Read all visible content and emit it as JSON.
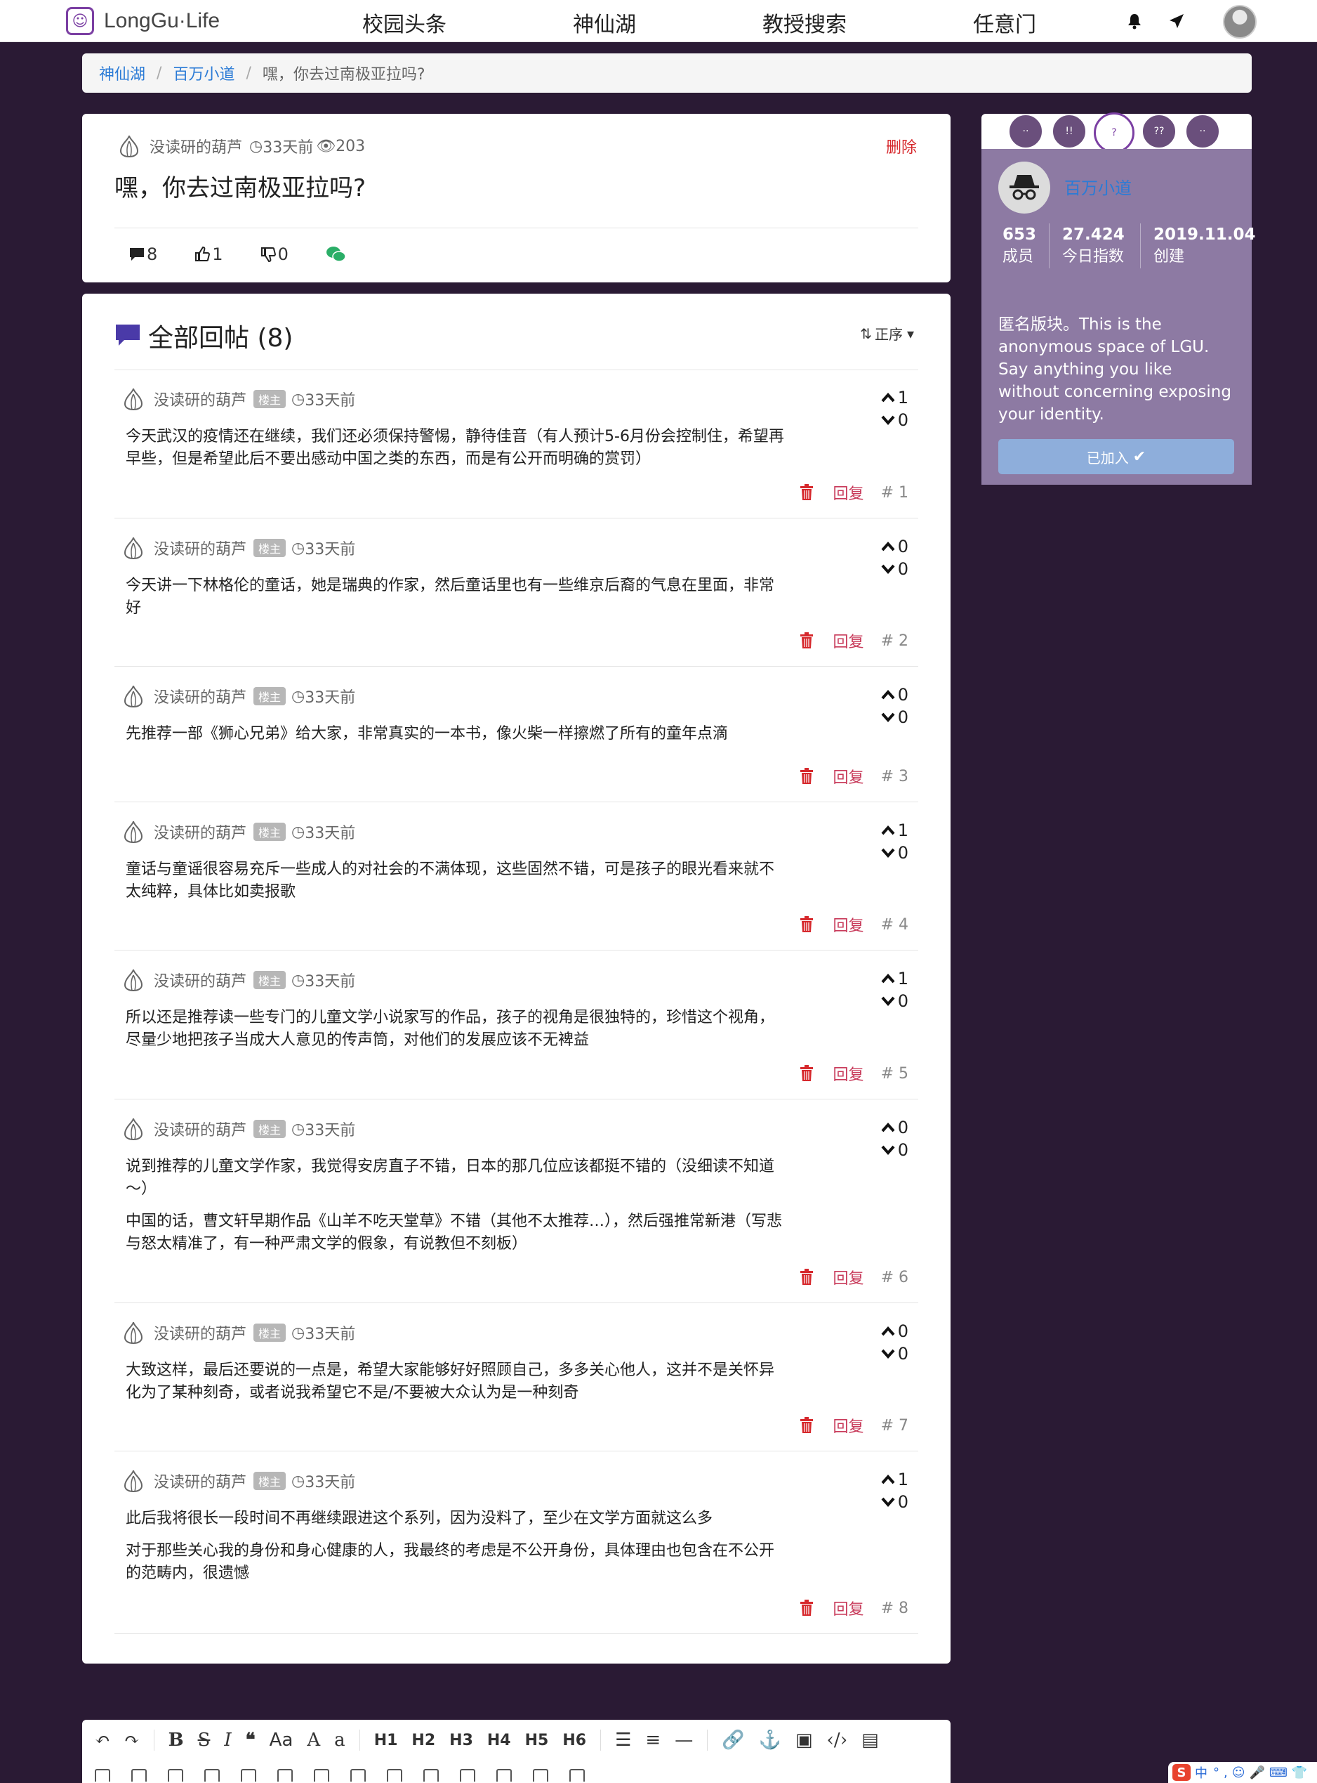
{
  "brand": {
    "name": "LongGu·Life"
  },
  "nav": [
    "校园头条",
    "神仙湖",
    "教授搜索",
    "任意门"
  ],
  "breadcrumb": [
    "神仙湖",
    "百万小道",
    "嘿，你去过南极亚拉吗?"
  ],
  "post": {
    "author": "没读研的葫芦",
    "time": "33天前",
    "views": "203",
    "delete_label": "删除",
    "title": "嘿，你去过南极亚拉吗?",
    "comments": "8",
    "likes": "1",
    "dislikes": "0"
  },
  "replies_header": {
    "title": "全部回帖 (8)",
    "sort_label": "正序"
  },
  "reply_labels": {
    "owner_tag": "楼主",
    "reply": "回复"
  },
  "replies": [
    {
      "author": "没读研的葫芦",
      "time": "33天前",
      "up": "1",
      "down": "0",
      "floor": "# 1",
      "paragraphs": [
        "今天武汉的疫情还在继续，我们还必须保持警惕，静待佳音（有人预计5-6月份会控制住，希望再早些，但是希望此后不要出感动中国之类的东西，而是有公开而明确的赏罚）"
      ]
    },
    {
      "author": "没读研的葫芦",
      "time": "33天前",
      "up": "0",
      "down": "0",
      "floor": "# 2",
      "paragraphs": [
        "今天讲一下林格伦的童话，她是瑞典的作家，然后童话里也有一些维京后裔的气息在里面，非常好"
      ]
    },
    {
      "author": "没读研的葫芦",
      "time": "33天前",
      "up": "0",
      "down": "0",
      "floor": "# 3",
      "paragraphs": [
        "先推荐一部《狮心兄弟》给大家，非常真实的一本书，像火柴一样擦燃了所有的童年点滴"
      ]
    },
    {
      "author": "没读研的葫芦",
      "time": "33天前",
      "up": "1",
      "down": "0",
      "floor": "# 4",
      "paragraphs": [
        "童话与童谣很容易充斥一些成人的对社会的不满体现，这些固然不错，可是孩子的眼光看来就不太纯粹，具体比如卖报歌"
      ]
    },
    {
      "author": "没读研的葫芦",
      "time": "33天前",
      "up": "1",
      "down": "0",
      "floor": "# 5",
      "paragraphs": [
        "所以还是推荐读一些专门的儿童文学小说家写的作品，孩子的视角是很独特的，珍惜这个视角，尽量少地把孩子当成大人意见的传声筒，对他们的发展应该不无裨益"
      ]
    },
    {
      "author": "没读研的葫芦",
      "time": "33天前",
      "up": "0",
      "down": "0",
      "floor": "# 6",
      "paragraphs": [
        "说到推荐的儿童文学作家，我觉得安房直子不错，日本的那几位应该都挺不错的（没细读不知道～）",
        "中国的话，曹文轩早期作品《山羊不吃天堂草》不错（其他不太推荐…），然后强推常新港（写悲与怒太精准了，有一种严肃文学的假象，有说教但不刻板）"
      ]
    },
    {
      "author": "没读研的葫芦",
      "time": "33天前",
      "up": "0",
      "down": "0",
      "floor": "# 7",
      "paragraphs": [
        "大致这样，最后还要说的一点是，希望大家能够好好照顾自己，多多关心他人，这并不是关怀异化为了某种刻奇，或者说我希望它不是/不要被大众认为是一种刻奇"
      ]
    },
    {
      "author": "没读研的葫芦",
      "time": "33天前",
      "up": "1",
      "down": "0",
      "floor": "# 8",
      "paragraphs": [
        "此后我将很长一段时间不再继续跟进这个系列，因为没料了，至少在文学方面就这么多",
        "对于那些关心我的身份和身心健康的人，我最终的考虑是不公开身份，具体理由也包含在不公开的范畴内，很遗憾"
      ]
    }
  ],
  "side": {
    "group_name": "百万小道",
    "members": "653",
    "members_label": "成员",
    "index": "27.424",
    "index_label": "今日指数",
    "created": "2019.11.04",
    "created_label": "创建",
    "description": "匿名版块。This is the anonymous space of LGU. Say anything you like without concerning exposing your identity.",
    "join_label": "已加入"
  },
  "editor": {
    "headings": [
      "H1",
      "H2",
      "H3",
      "H4",
      "H5",
      "H6"
    ],
    "aa_label": "Aa"
  },
  "ime": {
    "label": "中"
  },
  "colors": {
    "accent": "#7b3fa3",
    "link": "#2b7bd6",
    "danger": "#d6282c",
    "panel": "#8d7aa3",
    "bg": "#2a1a34"
  }
}
